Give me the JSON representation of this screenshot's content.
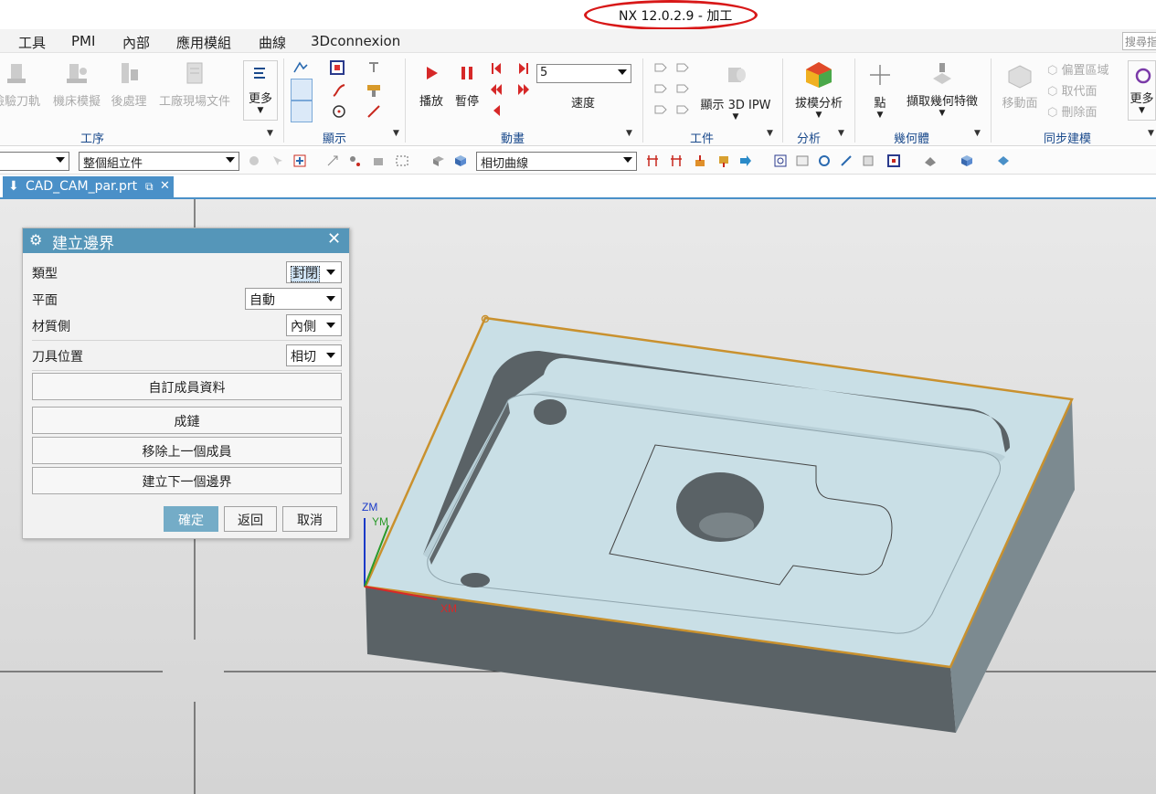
{
  "title_bar": {
    "title": "NX 12.0.2.9 - 加工"
  },
  "menu": {
    "items": [
      "工具",
      "PMI",
      "內部",
      "應用模組",
      "曲線",
      "3Dconnexion"
    ],
    "search_placeholder": "搜尋指"
  },
  "ribbon": {
    "ops_buttons": [
      "檢驗刀軌",
      "機床模擬",
      "後處理",
      "工廠現場文件"
    ],
    "more_label": "更多",
    "play_label": "播放",
    "pause_label": "暫停",
    "speed_value": "5",
    "speed_label": "速度",
    "show_ipw_label": "顯示 3D IPW",
    "draft_analysis_label": "拔模分析",
    "point_label": "點",
    "extract_geom_label": "擷取幾何特徵",
    "move_face_label": "移動面",
    "offset_region_label": "偏置區域",
    "replace_face_label": "取代面",
    "delete_face_label": "刪除面",
    "more2_label": "更多",
    "groups": [
      "工序",
      "顯示",
      "動畫",
      "工件",
      "分析",
      "幾何體",
      "同步建模"
    ]
  },
  "toolbar2": {
    "combo_filter": "",
    "combo_scope": "整個組立件",
    "combo_curve": "相切曲線"
  },
  "tab": {
    "label": "CAD_CAM_par.prt"
  },
  "dialog": {
    "title": "建立邊界",
    "type_label": "類型",
    "type_value": "封閉",
    "plane_label": "平面",
    "plane_value": "自動",
    "material_label": "材質側",
    "material_value": "內側",
    "tool_pos_label": "刀具位置",
    "tool_pos_value": "相切",
    "custom_btn": "自訂成員資料",
    "chain_btn": "成鏈",
    "remove_btn": "移除上一個成員",
    "next_btn": "建立下一個邊界",
    "ok": "確定",
    "back": "返回",
    "cancel": "取消"
  },
  "axes": {
    "zm": "ZM",
    "ym": "YM",
    "xm": "XM"
  },
  "colors": {
    "tab": "#4a90c8",
    "dialog_header": "#5596b9",
    "ok_button": "#74acc7",
    "boundary": "#c9912e",
    "title_highlight": "#d81818"
  }
}
